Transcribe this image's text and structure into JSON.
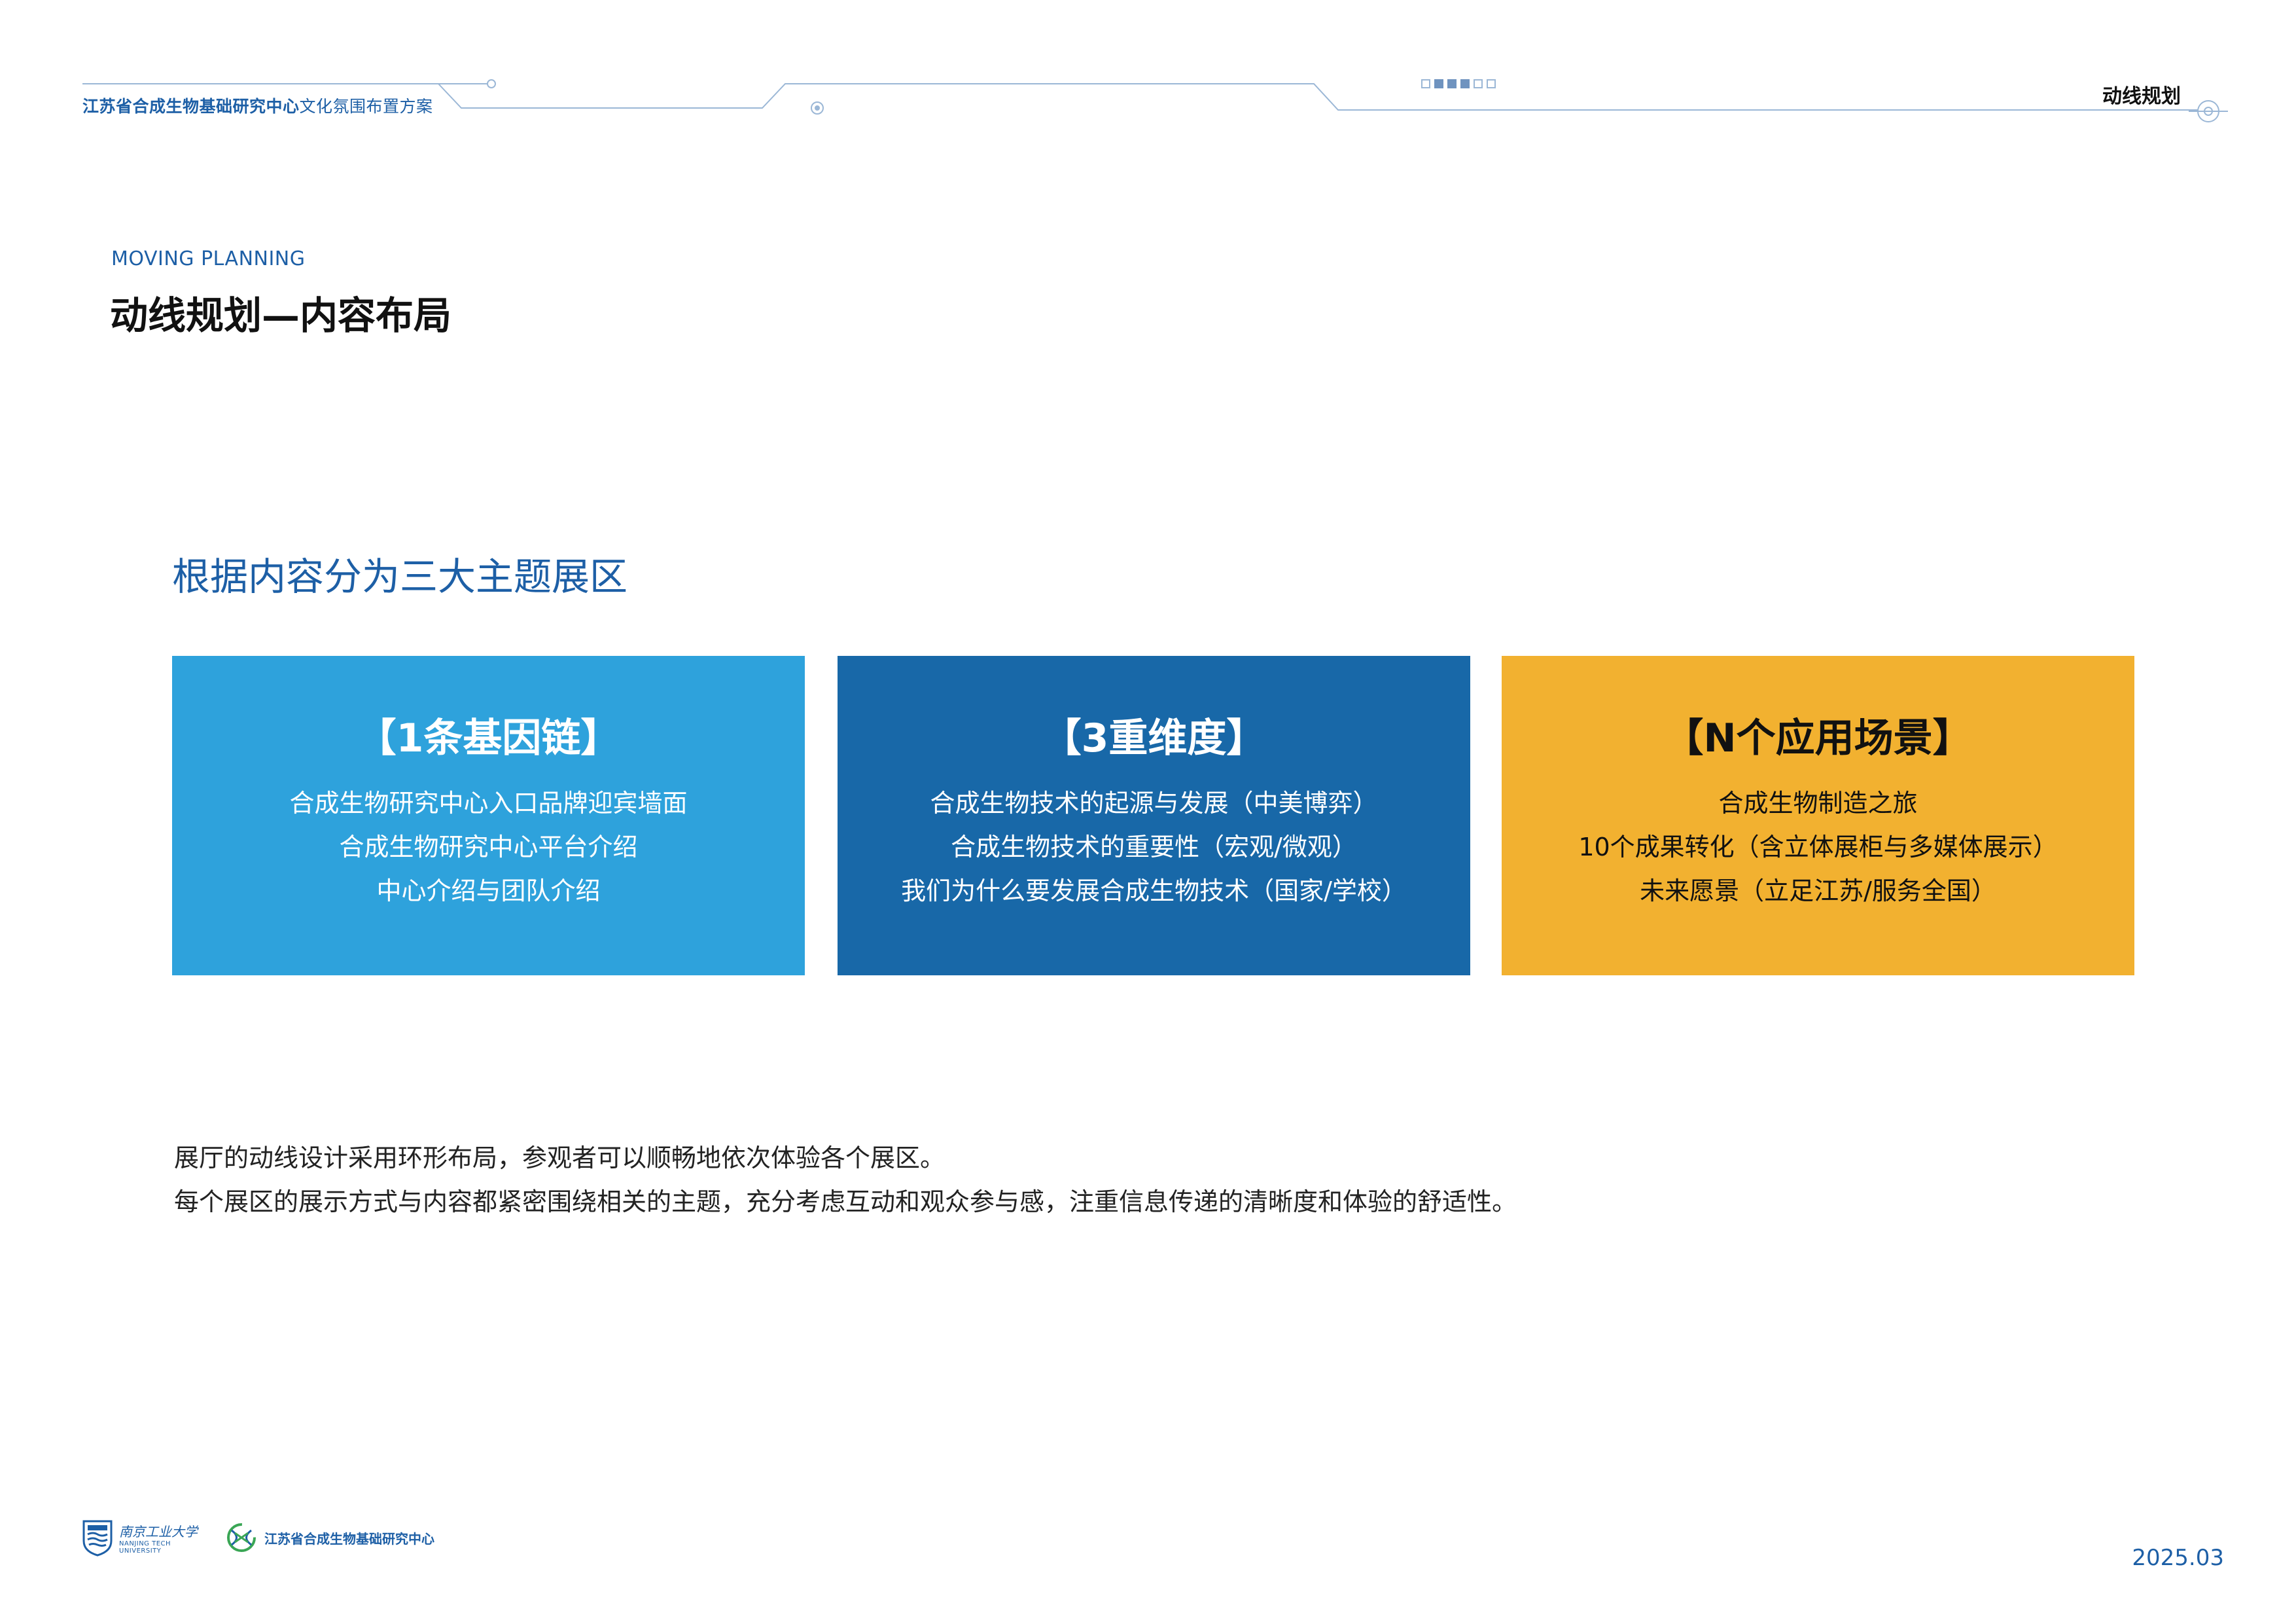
{
  "header": {
    "left_title_bold": "江苏省合成生物基础研究中心",
    "left_title_light": "文化氛围布置方案",
    "right_title": "动线规划"
  },
  "section": {
    "eyebrow": "MOVING PLANNING",
    "title": "动线规划—内容布局"
  },
  "subtitle": "根据内容分为三大主题展区",
  "cards": [
    {
      "title": "【1条基因链】",
      "lines": [
        "合成生物研究中心入口品牌迎宾墙面",
        "合成生物研究中心平台介绍",
        "中心介绍与团队介绍"
      ],
      "color": "#2ea2dc"
    },
    {
      "title": "【3重维度】",
      "lines": [
        "合成生物技术的起源与发展（中美博弈）",
        "合成生物技术的重要性（宏观/微观）",
        "我们为什么要发展合成生物技术（国家/学校）"
      ],
      "color": "#1868a8"
    },
    {
      "title": "【N个应用场景】",
      "lines": [
        "合成生物制造之旅",
        "10个成果转化（含立体展柜与多媒体展示）",
        "未来愿景（立足江苏/服务全国）"
      ],
      "color": "#f2b130"
    }
  ],
  "body": {
    "line1": "展厅的动线设计采用环形布局，参观者可以顺畅地依次体验各个展区。",
    "line2": "每个展区的展示方式与内容都紧密围绕相关的主题，充分考虑互动和观众参与感，注重信息传递的清晰度和体验的舒适性。"
  },
  "footer": {
    "university_script": "南京工业大学",
    "university_en_1": "NANJING TECH",
    "university_en_2": "UNIVERSITY",
    "center_name": "江苏省合成生物基础研究中心",
    "date": "2025.03"
  },
  "colors": {
    "brand_blue": "#1d5fa6",
    "line_blue": "#9bb7d6"
  },
  "icons": {
    "university_logo": "university-crest-icon",
    "center_logo": "dna-ring-logo-icon"
  }
}
